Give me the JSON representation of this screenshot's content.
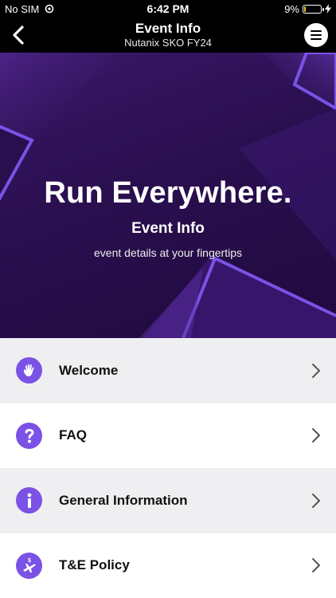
{
  "statusbar": {
    "carrier": "No SIM",
    "time": "6:42 PM",
    "battery_text": "9%",
    "battery_level": 0.09
  },
  "nav": {
    "title": "Event Info",
    "subtitle": "Nutanix SKO FY24",
    "back_icon": "chevron-left-icon",
    "menu_icon": "hamburger-menu-icon"
  },
  "hero": {
    "headline": "Run Everywhere.",
    "title": "Event Info",
    "subtitle": "event details at your fingertips"
  },
  "colors": {
    "accent": "#7b52e6",
    "hero_bg": "#2a0f4f",
    "row_shaded": "#efeff1"
  },
  "list": {
    "items": [
      {
        "label": "Welcome",
        "icon": "waving-hand-icon"
      },
      {
        "label": "FAQ",
        "icon": "question-mark-icon"
      },
      {
        "label": "General Information",
        "icon": "info-icon"
      },
      {
        "label": "T&E Policy",
        "icon": "airplane-dollar-icon"
      }
    ]
  }
}
